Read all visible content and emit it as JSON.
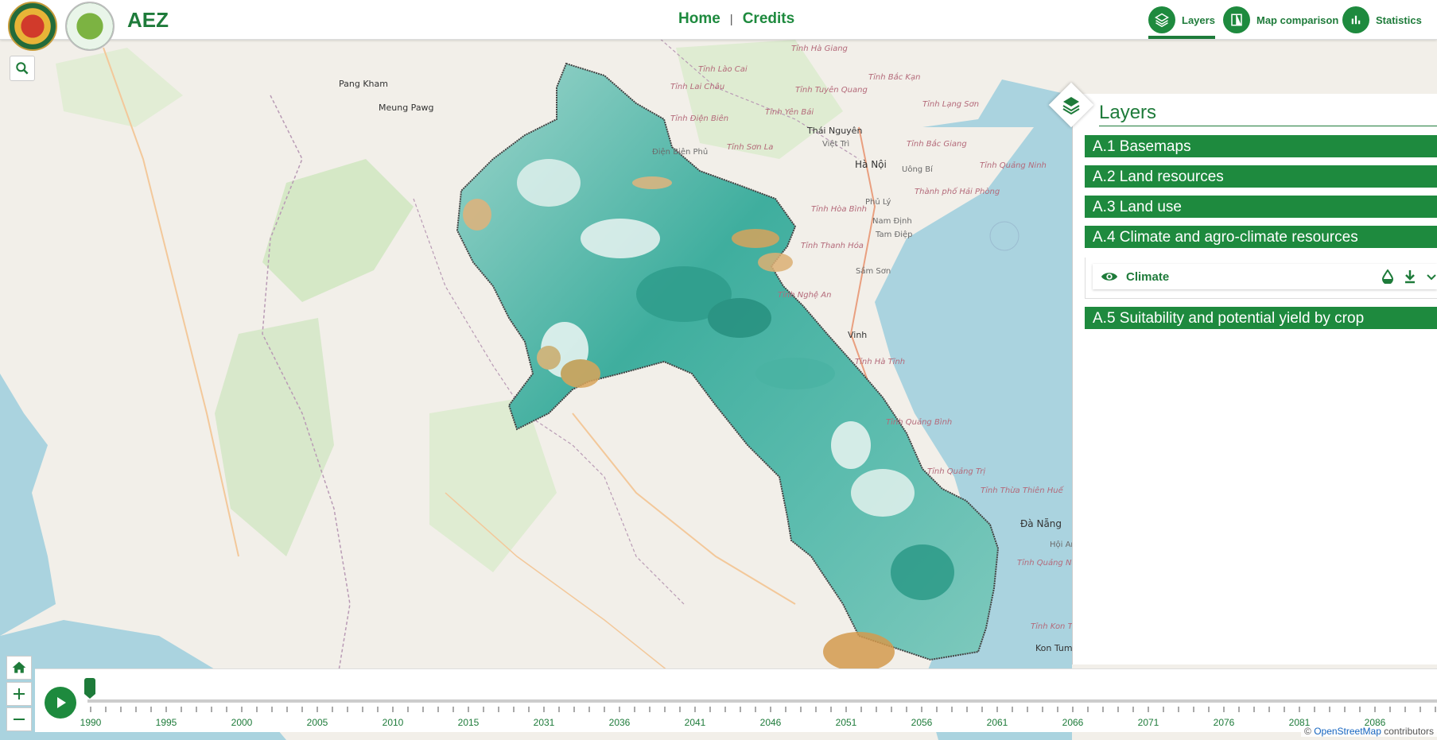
{
  "app": {
    "title": "AEZ"
  },
  "nav": {
    "home": "Home",
    "separator": "|",
    "credits": "Credits"
  },
  "tabs": {
    "layers": "Layers",
    "map_comparison": "Map comparison",
    "statistics": "Statistics"
  },
  "layers_panel": {
    "title": "Layers",
    "groups": [
      "A.1 Basemaps",
      "A.2 Land resources",
      "A.3 Land use",
      "A.4 Climate and agro-climate resources",
      "A.5 Suitability and potential yield by crop"
    ],
    "expanded_layer": {
      "name": "Climate"
    }
  },
  "timeline": {
    "years": [
      "1990",
      "1995",
      "2000",
      "2005",
      "2010",
      "2015",
      "2031",
      "2036",
      "2041",
      "2046",
      "2051",
      "2056",
      "2061",
      "2066",
      "2071",
      "2076",
      "2081",
      "2086"
    ],
    "current_year": "1990",
    "progress": 0
  },
  "attribution": {
    "prefix": "©",
    "link": "OpenStreetMap",
    "suffix": "contributors"
  },
  "colors": {
    "brand_green": "#1e8a3e",
    "water": "#aad3df",
    "land": "#f2efe9",
    "teal": "#3aaf9f"
  },
  "map_labels": {
    "cities": [
      "Thái Nguyên",
      "Hà Nội",
      "Vinh",
      "Đà Nẵng",
      "Kon Tum",
      "Phủ Lý",
      "Nam Định",
      "Tam Điệp",
      "Sầm Sơn",
      "Việt Trì",
      "Uông Bí",
      "Hội An",
      "Điện Biên Phủ",
      "Pang Kham",
      "Meung Pawg"
    ],
    "provinces": [
      "Tỉnh Lào Cai",
      "Tỉnh Lai Châu",
      "Tỉnh Điện Biên",
      "Tỉnh Sơn La",
      "Tỉnh Yên Bái",
      "Tỉnh Tuyên Quang",
      "Tỉnh Hà Giang",
      "Tỉnh Bắc Kạn",
      "Tỉnh Lạng Sơn",
      "Tỉnh Bắc Giang",
      "Tỉnh Quảng Ninh",
      "Thành phố Hải Phòng",
      "Tỉnh Hòa Bình",
      "Tỉnh Thanh Hóa",
      "Tỉnh Nghệ An",
      "Tỉnh Hà Tĩnh",
      "Tỉnh Quảng Bình",
      "Tỉnh Quảng Trị",
      "Tỉnh Thừa Thiên Huế",
      "Tỉnh Quảng Nam",
      "Tỉnh Kon Tum"
    ]
  }
}
